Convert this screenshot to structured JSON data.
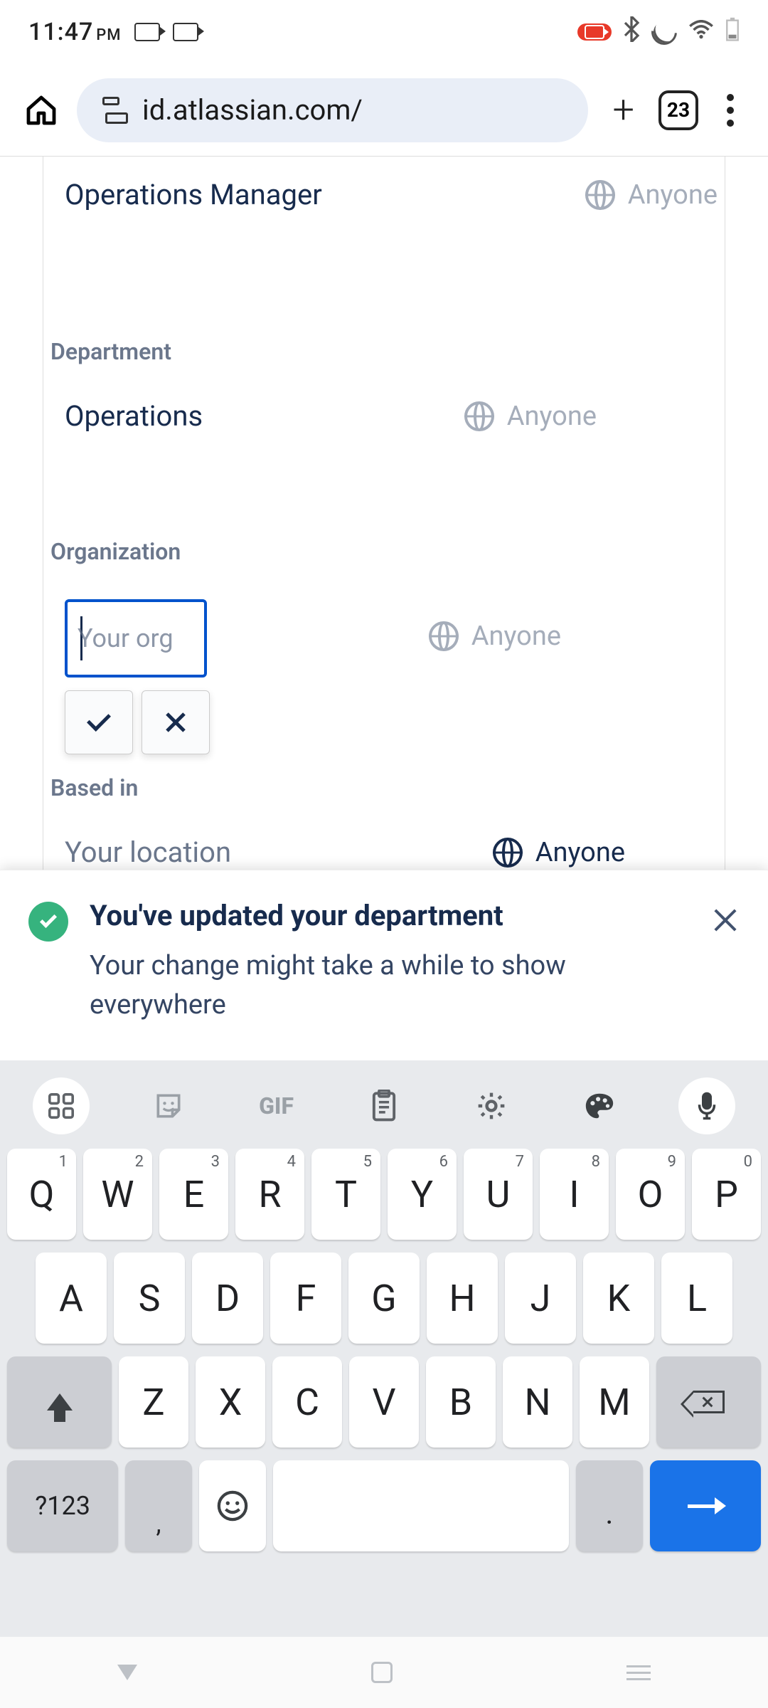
{
  "status": {
    "time": "11:47",
    "ampm": "PM"
  },
  "chrome": {
    "url": "id.atlassian.com/",
    "tab_count": "23"
  },
  "fields": {
    "job_title_value": "Operations Manager",
    "job_title_visibility": "Anyone",
    "department_label": "Department",
    "department_value": "Operations",
    "department_visibility": "Anyone",
    "organization_label": "Organization",
    "organization_placeholder": "Your org",
    "organization_visibility": "Anyone",
    "based_in_label": "Based in",
    "based_in_placeholder": "Your location",
    "based_in_visibility": "Anyone"
  },
  "toast": {
    "title": "You've updated your department",
    "message": "Your change might take a while to show everywhere"
  },
  "keyboard": {
    "toolbar": {
      "gif": "GIF"
    },
    "row1": [
      {
        "k": "Q",
        "s": "1"
      },
      {
        "k": "W",
        "s": "2"
      },
      {
        "k": "E",
        "s": "3"
      },
      {
        "k": "R",
        "s": "4"
      },
      {
        "k": "T",
        "s": "5"
      },
      {
        "k": "Y",
        "s": "6"
      },
      {
        "k": "U",
        "s": "7"
      },
      {
        "k": "I",
        "s": "8"
      },
      {
        "k": "O",
        "s": "9"
      },
      {
        "k": "P",
        "s": "0"
      }
    ],
    "row2": [
      "A",
      "S",
      "D",
      "F",
      "G",
      "H",
      "J",
      "K",
      "L"
    ],
    "row3": [
      "Z",
      "X",
      "C",
      "V",
      "B",
      "N",
      "M"
    ],
    "sym": "?123",
    "comma": ",",
    "period": "."
  }
}
